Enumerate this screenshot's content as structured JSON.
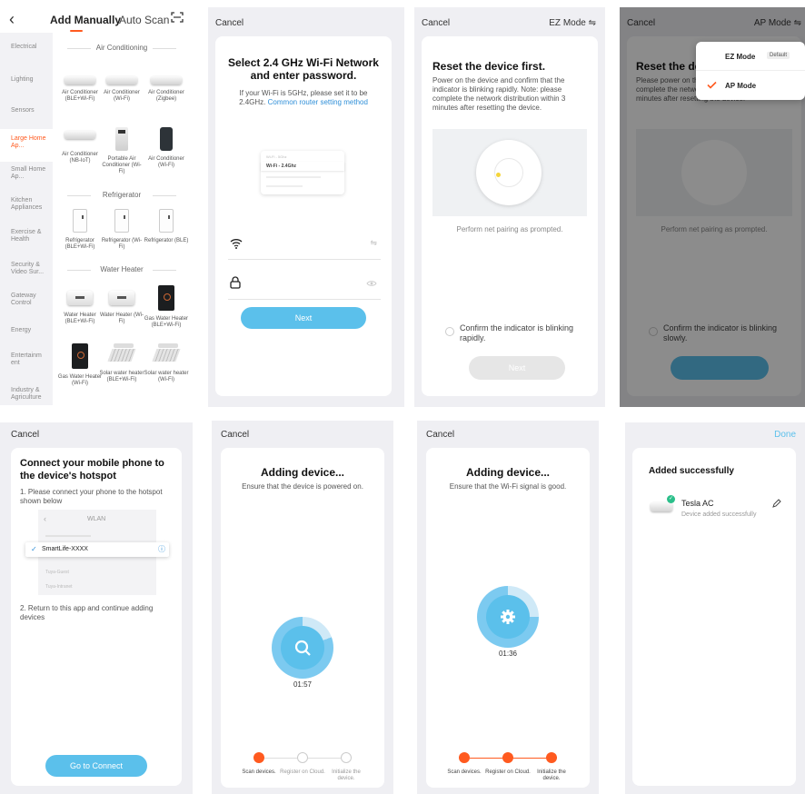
{
  "screen1": {
    "tab_manual": "Add Manually",
    "tab_scan": "Auto Scan",
    "sidebar": [
      "Electrical",
      "Lighting",
      "Sensors",
      "Large Home Ap...",
      "Small Home Ap...",
      "Kitchen Appliances",
      "Exercise & Health",
      "Security & Video Sur...",
      "Gateway Control",
      "Energy",
      "Entertainm ent",
      "Industry & Agriculture"
    ],
    "section_ac": "Air Conditioning",
    "ac_devices": [
      "Air Conditioner (BLE+Wi-Fi)",
      "Air Conditioner (Wi-Fi)",
      "Air Conditioner (Zigbee)",
      "Air Conditioner (NB-IoT)",
      "Portable Air Conditioner (Wi-Fi)",
      "Air Conditioner (Wi-Fi)"
    ],
    "section_fridge": "Refrigerator",
    "fridge_devices": [
      "Refrigerator (BLE+Wi-Fi)",
      "Refrigerator (Wi-Fi)",
      "Refrigerator (BLE)"
    ],
    "section_heater": "Water Heater",
    "heater_devices": [
      "Water Heater (BLE+Wi-Fi)",
      "Water Heater (Wi-Fi)",
      "Gas Water Heater (BLE+Wi-Fi)",
      "Gas Water Heater (Wi-Fi)",
      "Solar water heater (BLE+Wi-Fi)",
      "Solar water heater (Wi-Fi)"
    ]
  },
  "screen2": {
    "cancel": "Cancel",
    "title": "Select 2.4 GHz Wi-Fi Network and enter password.",
    "desc": "If your Wi-Fi is 5GHz, please set it to be 2.4GHz.",
    "link": "Common router setting method",
    "mini_row1": "Wi-Fi - 5Ghz",
    "mini_row2": "Wi-Fi - 2.4Ghz",
    "next": "Next"
  },
  "screen3": {
    "cancel": "Cancel",
    "mode": "EZ Mode ⇋",
    "title": "Reset the device first.",
    "desc": "Power on the device and confirm that the indicator is blinking rapidly. Note: please complete the network distribution within 3 minutes after resetting the device.",
    "prompt": "Perform net pairing as prompted.",
    "confirm": "Confirm the indicator is blinking rapidly.",
    "next": "Next"
  },
  "screen4": {
    "cancel": "Cancel",
    "mode": "AP Mode ⇋",
    "title": "Reset the de",
    "desc": "Please power on the indicator is bli Note: please complete the network distribution within 3 minutes after resetting the device.",
    "prompt": "Perform net pairing as prompted.",
    "confirm": "Confirm the indicator is blinking slowly.",
    "menu_ez": "EZ Mode",
    "menu_default": "Default",
    "menu_ap": "AP Mode"
  },
  "screen5": {
    "cancel": "Cancel",
    "title": "Connect your mobile phone to the device's hotspot",
    "step1": "1. Please connect your phone to the hotspot shown below",
    "wlan": "WLAN",
    "hotspot": "SmartLife-XXXX",
    "guest": "Tuya-Guest",
    "intranet": "Tuya-Intranet",
    "step2": "2. Return to this app and continue adding devices",
    "button": "Go to Connect"
  },
  "screen6": {
    "cancel": "Cancel",
    "title": "Adding device...",
    "subtitle": "Ensure that the device is powered on.",
    "timer": "01:57",
    "steps": [
      "Scan devices.",
      "Register on Cloud.",
      "Initialize the device."
    ]
  },
  "screen7": {
    "cancel": "Cancel",
    "title": "Adding device...",
    "subtitle": "Ensure that the Wi-Fi signal is good.",
    "timer": "01:36",
    "steps": [
      "Scan devices.",
      "Register on Cloud.",
      "Initialize the device."
    ]
  },
  "screen8": {
    "done": "Done",
    "title": "Added successfully",
    "device_name": "Tesla AC",
    "device_status": "Device added successfully"
  },
  "colors": {
    "accent_orange": "#ff5a1f",
    "accent_blue": "#5bc0eb",
    "link_blue": "#2f8fd8",
    "gray_bg": "#efeff3"
  }
}
